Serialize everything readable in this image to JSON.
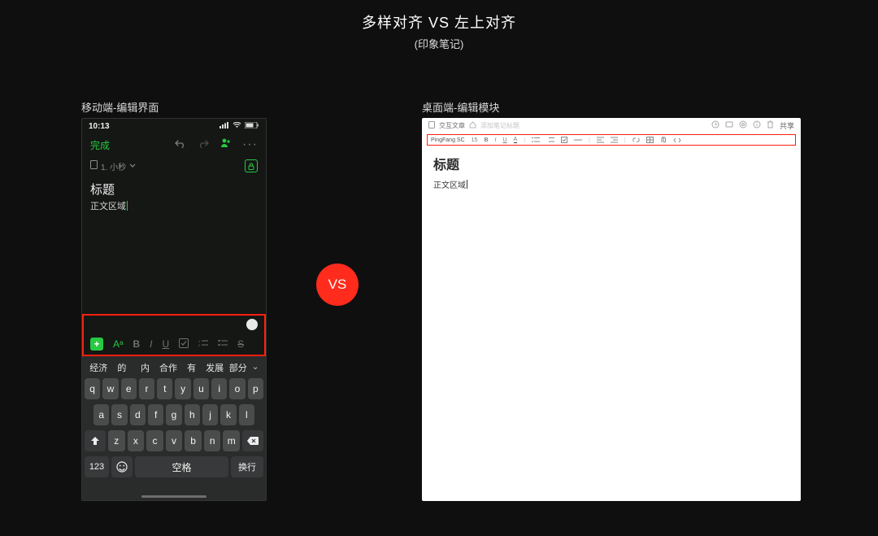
{
  "page": {
    "title": "多样对齐 VS 左上对齐",
    "subtitle": "(印象笔记)",
    "vs_label": "VS",
    "left_panel_label": "移动端-编辑界面",
    "right_panel_label": "桌面端-编辑模块"
  },
  "mobile": {
    "status_time": "10:13",
    "done_label": "完成",
    "crumb_note": "1. 小秒",
    "note_title": "标题",
    "note_body": "正文区域",
    "format": {
      "aa": "Aᵃ",
      "b": "B",
      "i": "I",
      "u": "U",
      "s": "S"
    },
    "suggestions": [
      "经济",
      "的",
      "内",
      "合作",
      "有",
      "发展",
      "部分"
    ],
    "rows": {
      "r1": [
        "q",
        "w",
        "e",
        "r",
        "t",
        "y",
        "u",
        "i",
        "o",
        "p"
      ],
      "r2": [
        "a",
        "s",
        "d",
        "f",
        "g",
        "h",
        "j",
        "k",
        "l"
      ],
      "r3": [
        "z",
        "x",
        "c",
        "v",
        "b",
        "n",
        "m"
      ]
    },
    "num_key": "123",
    "space_key": "空格",
    "return_key": "换行"
  },
  "desktop": {
    "crumb": "交互文章",
    "crumb_hint": "添加笔记标题",
    "share_label": "共享",
    "toolbar": {
      "font": "PingFang SC",
      "size": "15",
      "b": "B",
      "i": "I",
      "u": "U",
      "a": "A"
    },
    "title": "标题",
    "body": "正文区域"
  }
}
